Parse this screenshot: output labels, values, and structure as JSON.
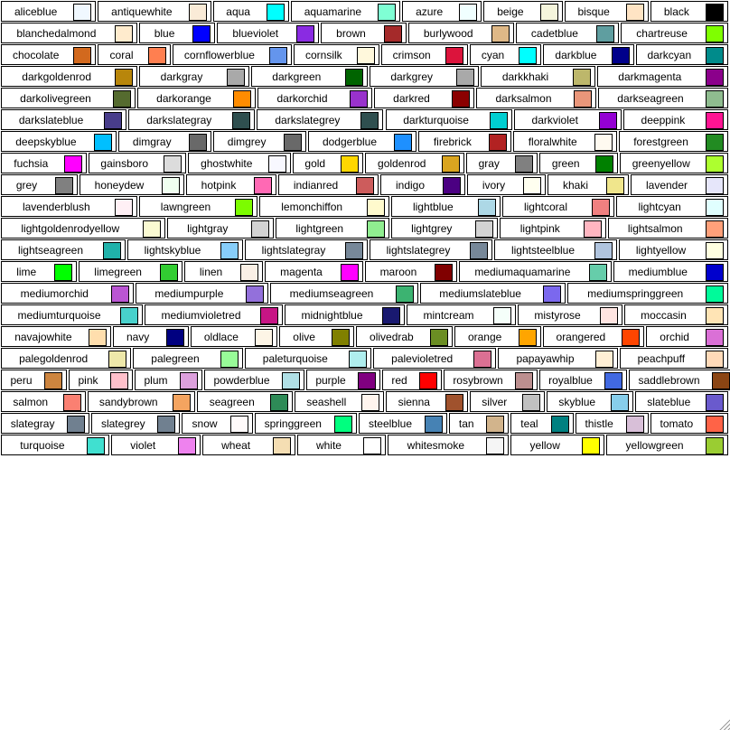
{
  "rows": [
    [
      {
        "name": "aliceblue",
        "hex": "#f0f8ff"
      },
      {
        "name": "antiquewhite",
        "hex": "#faebd7"
      },
      {
        "name": "aqua",
        "hex": "#00ffff"
      },
      {
        "name": "aquamarine",
        "hex": "#7fffd4"
      },
      {
        "name": "azure",
        "hex": "#f0ffff"
      },
      {
        "name": "beige",
        "hex": "#f5f5dc"
      },
      {
        "name": "bisque",
        "hex": "#ffe4c4"
      },
      {
        "name": "black",
        "hex": "#000000"
      }
    ],
    [
      {
        "name": "blanchedalmond",
        "hex": "#ffebcd"
      },
      {
        "name": "blue",
        "hex": "#0000ff"
      },
      {
        "name": "blueviolet",
        "hex": "#8a2be2"
      },
      {
        "name": "brown",
        "hex": "#a52a2a"
      },
      {
        "name": "burlywood",
        "hex": "#deb887"
      },
      {
        "name": "cadetblue",
        "hex": "#5f9ea0"
      },
      {
        "name": "chartreuse",
        "hex": "#7fff00"
      }
    ],
    [
      {
        "name": "chocolate",
        "hex": "#d2691e"
      },
      {
        "name": "coral",
        "hex": "#ff7f50"
      },
      {
        "name": "cornflowerblue",
        "hex": "#6495ed"
      },
      {
        "name": "cornsilk",
        "hex": "#fff8dc"
      },
      {
        "name": "crimson",
        "hex": "#dc143c"
      },
      {
        "name": "cyan",
        "hex": "#00ffff"
      },
      {
        "name": "darkblue",
        "hex": "#00008b"
      },
      {
        "name": "darkcyan",
        "hex": "#008b8b"
      }
    ],
    [
      {
        "name": "darkgoldenrod",
        "hex": "#b8860b"
      },
      {
        "name": "darkgray",
        "hex": "#a9a9a9"
      },
      {
        "name": "darkgreen",
        "hex": "#006400"
      },
      {
        "name": "darkgrey",
        "hex": "#a9a9a9"
      },
      {
        "name": "darkkhaki",
        "hex": "#bdb76b"
      },
      {
        "name": "darkmagenta",
        "hex": "#8b008b"
      }
    ],
    [
      {
        "name": "darkolivegreen",
        "hex": "#556b2f"
      },
      {
        "name": "darkorange",
        "hex": "#ff8c00"
      },
      {
        "name": "darkorchid",
        "hex": "#9932cc"
      },
      {
        "name": "darkred",
        "hex": "#8b0000"
      },
      {
        "name": "darksalmon",
        "hex": "#e9967a"
      },
      {
        "name": "darkseagreen",
        "hex": "#8fbc8f"
      }
    ],
    [
      {
        "name": "darkslateblue",
        "hex": "#483d8b"
      },
      {
        "name": "darkslategray",
        "hex": "#2f4f4f"
      },
      {
        "name": "darkslategrey",
        "hex": "#2f4f4f"
      },
      {
        "name": "darkturquoise",
        "hex": "#00ced1"
      },
      {
        "name": "darkviolet",
        "hex": "#9400d3"
      },
      {
        "name": "deeppink",
        "hex": "#ff1493"
      }
    ],
    [
      {
        "name": "deepskyblue",
        "hex": "#00bfff"
      },
      {
        "name": "dimgray",
        "hex": "#696969"
      },
      {
        "name": "dimgrey",
        "hex": "#696969"
      },
      {
        "name": "dodgerblue",
        "hex": "#1e90ff"
      },
      {
        "name": "firebrick",
        "hex": "#b22222"
      },
      {
        "name": "floralwhite",
        "hex": "#fffaf0"
      },
      {
        "name": "forestgreen",
        "hex": "#228b22"
      }
    ],
    [
      {
        "name": "fuchsia",
        "hex": "#ff00ff"
      },
      {
        "name": "gainsboro",
        "hex": "#dcdcdc"
      },
      {
        "name": "ghostwhite",
        "hex": "#f8f8ff"
      },
      {
        "name": "gold",
        "hex": "#ffd700"
      },
      {
        "name": "goldenrod",
        "hex": "#daa520"
      },
      {
        "name": "gray",
        "hex": "#808080"
      },
      {
        "name": "green",
        "hex": "#008000"
      },
      {
        "name": "greenyellow",
        "hex": "#adff2f"
      }
    ],
    [
      {
        "name": "grey",
        "hex": "#808080"
      },
      {
        "name": "honeydew",
        "hex": "#f0fff0"
      },
      {
        "name": "hotpink",
        "hex": "#ff69b4"
      },
      {
        "name": "indianred",
        "hex": "#cd5c5c"
      },
      {
        "name": "indigo",
        "hex": "#4b0082"
      },
      {
        "name": "ivory",
        "hex": "#fffff0"
      },
      {
        "name": "khaki",
        "hex": "#f0e68c"
      },
      {
        "name": "lavender",
        "hex": "#e6e6fa"
      }
    ],
    [
      {
        "name": "lavenderblush",
        "hex": "#fff0f5"
      },
      {
        "name": "lawngreen",
        "hex": "#7cfc00"
      },
      {
        "name": "lemonchiffon",
        "hex": "#fffacd"
      },
      {
        "name": "lightblue",
        "hex": "#add8e6"
      },
      {
        "name": "lightcoral",
        "hex": "#f08080"
      },
      {
        "name": "lightcyan",
        "hex": "#e0ffff"
      }
    ],
    [
      {
        "name": "lightgoldenrodyellow",
        "hex": "#fafad2"
      },
      {
        "name": "lightgray",
        "hex": "#d3d3d3"
      },
      {
        "name": "lightgreen",
        "hex": "#90ee90"
      },
      {
        "name": "lightgrey",
        "hex": "#d3d3d3"
      },
      {
        "name": "lightpink",
        "hex": "#ffb6c1"
      },
      {
        "name": "lightsalmon",
        "hex": "#ffa07a"
      }
    ],
    [
      {
        "name": "lightseagreen",
        "hex": "#20b2aa"
      },
      {
        "name": "lightskyblue",
        "hex": "#87cefa"
      },
      {
        "name": "lightslategray",
        "hex": "#778899"
      },
      {
        "name": "lightslategrey",
        "hex": "#778899"
      },
      {
        "name": "lightsteelblue",
        "hex": "#b0c4de"
      },
      {
        "name": "lightyellow",
        "hex": "#ffffe0"
      }
    ],
    [
      {
        "name": "lime",
        "hex": "#00ff00"
      },
      {
        "name": "limegreen",
        "hex": "#32cd32"
      },
      {
        "name": "linen",
        "hex": "#faf0e6"
      },
      {
        "name": "magenta",
        "hex": "#ff00ff"
      },
      {
        "name": "maroon",
        "hex": "#800000"
      },
      {
        "name": "mediumaquamarine",
        "hex": "#66cdaa"
      },
      {
        "name": "mediumblue",
        "hex": "#0000cd"
      }
    ],
    [
      {
        "name": "mediumorchid",
        "hex": "#ba55d3"
      },
      {
        "name": "mediumpurple",
        "hex": "#9370db"
      },
      {
        "name": "mediumseagreen",
        "hex": "#3cb371"
      },
      {
        "name": "mediumslateblue",
        "hex": "#7b68ee"
      },
      {
        "name": "mediumspringgreen",
        "hex": "#00fa9a"
      }
    ],
    [
      {
        "name": "mediumturquoise",
        "hex": "#48d1cc"
      },
      {
        "name": "mediumvioletred",
        "hex": "#c71585"
      },
      {
        "name": "midnightblue",
        "hex": "#191970"
      },
      {
        "name": "mintcream",
        "hex": "#f5fffa"
      },
      {
        "name": "mistyrose",
        "hex": "#ffe4e1"
      },
      {
        "name": "moccasin",
        "hex": "#ffe4b5"
      }
    ],
    [
      {
        "name": "navajowhite",
        "hex": "#ffdead"
      },
      {
        "name": "navy",
        "hex": "#000080"
      },
      {
        "name": "oldlace",
        "hex": "#fdf5e6"
      },
      {
        "name": "olive",
        "hex": "#808000"
      },
      {
        "name": "olivedrab",
        "hex": "#6b8e23"
      },
      {
        "name": "orange",
        "hex": "#ffa500"
      },
      {
        "name": "orangered",
        "hex": "#ff4500"
      },
      {
        "name": "orchid",
        "hex": "#da70d6"
      }
    ],
    [
      {
        "name": "palegoldenrod",
        "hex": "#eee8aa"
      },
      {
        "name": "palegreen",
        "hex": "#98fb98"
      },
      {
        "name": "paleturquoise",
        "hex": "#afeeee"
      },
      {
        "name": "palevioletred",
        "hex": "#db7093"
      },
      {
        "name": "papayawhip",
        "hex": "#ffefd5"
      },
      {
        "name": "peachpuff",
        "hex": "#ffdab9"
      }
    ],
    [
      {
        "name": "peru",
        "hex": "#cd853f"
      },
      {
        "name": "pink",
        "hex": "#ffc0cb"
      },
      {
        "name": "plum",
        "hex": "#dda0dd"
      },
      {
        "name": "powderblue",
        "hex": "#b0e0e6"
      },
      {
        "name": "purple",
        "hex": "#800080"
      },
      {
        "name": "red",
        "hex": "#ff0000"
      },
      {
        "name": "rosybrown",
        "hex": "#bc8f8f"
      },
      {
        "name": "royalblue",
        "hex": "#4169e1"
      },
      {
        "name": "saddlebrown",
        "hex": "#8b4513"
      }
    ],
    [
      {
        "name": "salmon",
        "hex": "#fa8072"
      },
      {
        "name": "sandybrown",
        "hex": "#f4a460"
      },
      {
        "name": "seagreen",
        "hex": "#2e8b57"
      },
      {
        "name": "seashell",
        "hex": "#fff5ee"
      },
      {
        "name": "sienna",
        "hex": "#a0522d"
      },
      {
        "name": "silver",
        "hex": "#c0c0c0"
      },
      {
        "name": "skyblue",
        "hex": "#87ceeb"
      },
      {
        "name": "slateblue",
        "hex": "#6a5acd"
      }
    ],
    [
      {
        "name": "slategray",
        "hex": "#708090"
      },
      {
        "name": "slategrey",
        "hex": "#708090"
      },
      {
        "name": "snow",
        "hex": "#fffafa"
      },
      {
        "name": "springgreen",
        "hex": "#00ff7f"
      },
      {
        "name": "steelblue",
        "hex": "#4682b4"
      },
      {
        "name": "tan",
        "hex": "#d2b48c"
      },
      {
        "name": "teal",
        "hex": "#008080"
      },
      {
        "name": "thistle",
        "hex": "#d8bfd8"
      },
      {
        "name": "tomato",
        "hex": "#ff6347"
      }
    ],
    [
      {
        "name": "turquoise",
        "hex": "#40e0d0"
      },
      {
        "name": "violet",
        "hex": "#ee82ee"
      },
      {
        "name": "wheat",
        "hex": "#f5deb3"
      },
      {
        "name": "white",
        "hex": "#ffffff"
      },
      {
        "name": "whitesmoke",
        "hex": "#f5f5f5"
      },
      {
        "name": "yellow",
        "hex": "#ffff00"
      },
      {
        "name": "yellowgreen",
        "hex": "#9acd32"
      }
    ]
  ]
}
